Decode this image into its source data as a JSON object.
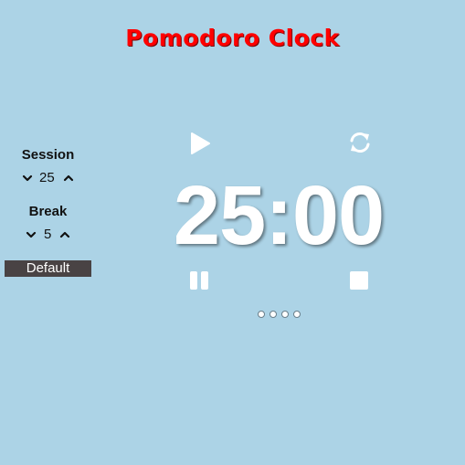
{
  "header": {
    "title": "Pomodoro Clock"
  },
  "settings": {
    "session": {
      "label": "Session",
      "value": "25",
      "decrement_icon": "chevron-down-icon",
      "increment_icon": "chevron-up-icon"
    },
    "break": {
      "label": "Break",
      "value": "5",
      "decrement_icon": "chevron-down-icon",
      "increment_icon": "chevron-up-icon"
    },
    "default_label": "Default"
  },
  "timer": {
    "display": "25:00",
    "controls": [
      "play-icon",
      "refresh-icon",
      "pause-icon",
      "stop-icon"
    ],
    "progress_dots": 4
  },
  "colors": {
    "background": "#acd3e6",
    "title": "#ff0000",
    "button_bg": "#494344",
    "timer_text": "#ffffff"
  }
}
